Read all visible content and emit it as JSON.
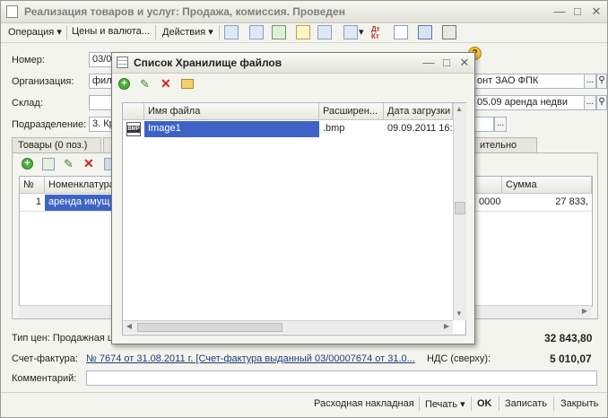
{
  "window": {
    "title": "Реализация товаров и услуг: Продажа, комиссия. Проведен"
  },
  "toolbar": {
    "operation": "Операция",
    "prices": "Цены и валюта...",
    "actions": "Действия"
  },
  "form": {
    "number_label": "Номер:",
    "number_value": "03/0",
    "org_label": "Организация:",
    "org_value": "фил",
    "warehouse_label": "Склад:",
    "division_label": "Подразделение:",
    "division_value": "3. Кр",
    "counterparty_value": "онт ЗАО ФПК",
    "contract_value": "05.09 аренда недви"
  },
  "tabs": {
    "goods": "Товары (0 поз.)",
    "extra": "ительно"
  },
  "table": {
    "headers": {
      "num": "№",
      "nomenclature": "Номенклатура",
      "sum": "Сумма"
    },
    "row": {
      "num": "1",
      "nomenclature": "аренда имущ",
      "qty": "0000",
      "sum": "27 833,"
    }
  },
  "footer": {
    "price_type_label": "Тип цен: Продажная ц",
    "total": "32 843,80",
    "invoice_label": "Счет-фактура:",
    "invoice_link": "№ 7674 от 31.08.2011 г. [Счет-фактура выданный 03/00007674 от 31.0...",
    "vat_label": "НДС (сверху):",
    "vat_value": "5 010,07",
    "comment_label": "Комментарий:"
  },
  "bottom_bar": {
    "waybill": "Расходная накладная",
    "print": "Печать",
    "ok": "OK",
    "save": "Записать",
    "close": "Закрыть"
  },
  "dialog": {
    "title": "Список Хранилище файлов",
    "headers": {
      "filename": "Имя файла",
      "extension": "Расширен...",
      "date": "Дата загрузки"
    },
    "row": {
      "icon_text": "BMP",
      "filename": "Image1",
      "extension": ".bmp",
      "date": "09.09.2011 16:"
    }
  }
}
